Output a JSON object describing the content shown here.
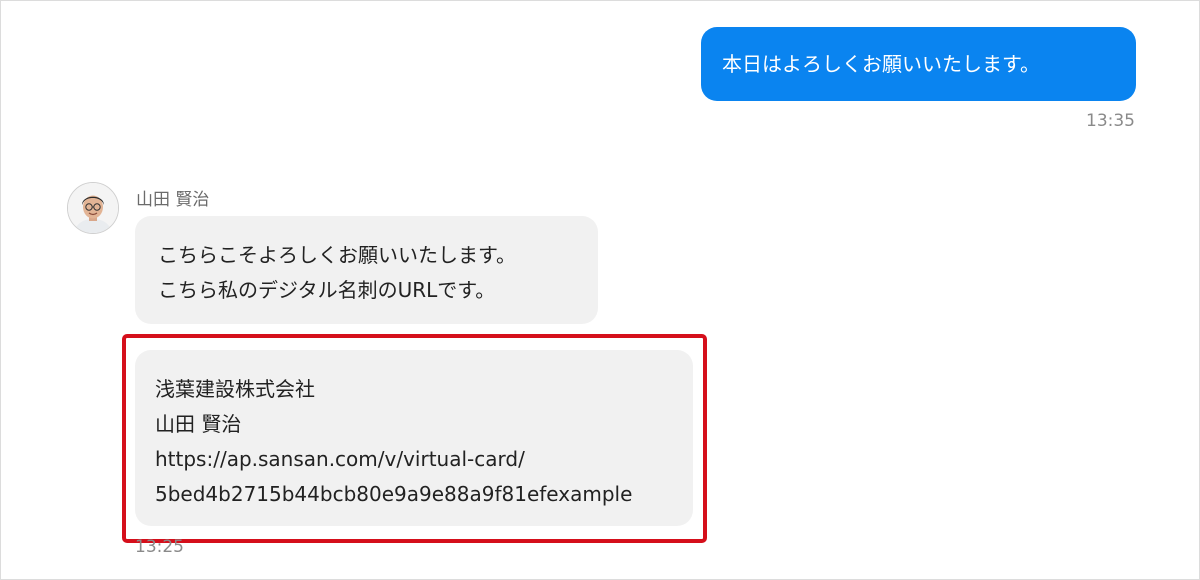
{
  "conversation": {
    "outgoing": {
      "text": "本日はよろしくお願いいたします。",
      "time": "13:35"
    },
    "incoming": {
      "sender_name": "山田 賢治",
      "message_1": {
        "line_1": "こちらこそよろしくお願いいたします。",
        "line_2": "こちら私のデジタル名刺のURLです。"
      },
      "message_2": {
        "company": "浅葉建設株式会社",
        "name": "山田 賢治",
        "url_line_1": "https://ap.sansan.com/v/virtual-card/",
        "url_line_2": "5bed4b2715b44bcb80e9a9e88a9f81efexample"
      },
      "time": "13:25"
    }
  },
  "colors": {
    "outgoing_bubble": "#0a84f0",
    "incoming_bubble": "#f1f1f1",
    "highlight_border": "#d50f1b"
  },
  "icons": {
    "avatar": "user-avatar-photo"
  }
}
